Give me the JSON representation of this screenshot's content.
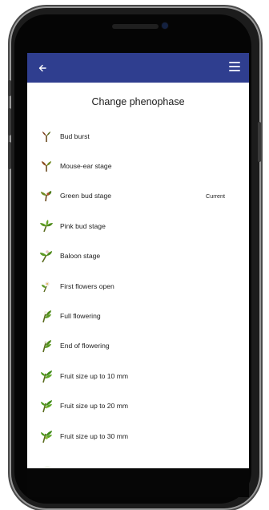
{
  "app_bar": {
    "back_icon": "arrow-left-icon",
    "menu_icon": "hamburger-menu-icon",
    "color": "#2f3e8f"
  },
  "page": {
    "title": "Change phenophase"
  },
  "phenophases": [
    {
      "label": "Bud burst",
      "icon": "bud-burst-icon",
      "current": ""
    },
    {
      "label": "Mouse-ear stage",
      "icon": "mouse-ear-icon",
      "current": ""
    },
    {
      "label": "Green bud stage",
      "icon": "green-bud-icon",
      "current": "Current"
    },
    {
      "label": "Pink bud stage",
      "icon": "pink-bud-icon",
      "current": ""
    },
    {
      "label": "Baloon stage",
      "icon": "baloon-stage-icon",
      "current": ""
    },
    {
      "label": "First flowers open",
      "icon": "first-flowers-icon",
      "current": ""
    },
    {
      "label": "Full flowering",
      "icon": "full-flowering-icon",
      "current": ""
    },
    {
      "label": "End of flowering",
      "icon": "end-flowering-icon",
      "current": ""
    },
    {
      "label": "Fruit size up to 10 mm",
      "icon": "fruit-10mm-icon",
      "current": ""
    },
    {
      "label": "Fruit size up to 20 mm",
      "icon": "fruit-20mm-icon",
      "current": ""
    },
    {
      "label": "Fruit size up to 30 mm",
      "icon": "fruit-30mm-icon",
      "current": ""
    },
    {
      "label": "",
      "icon": "partial-item-icon",
      "current": ""
    }
  ]
}
